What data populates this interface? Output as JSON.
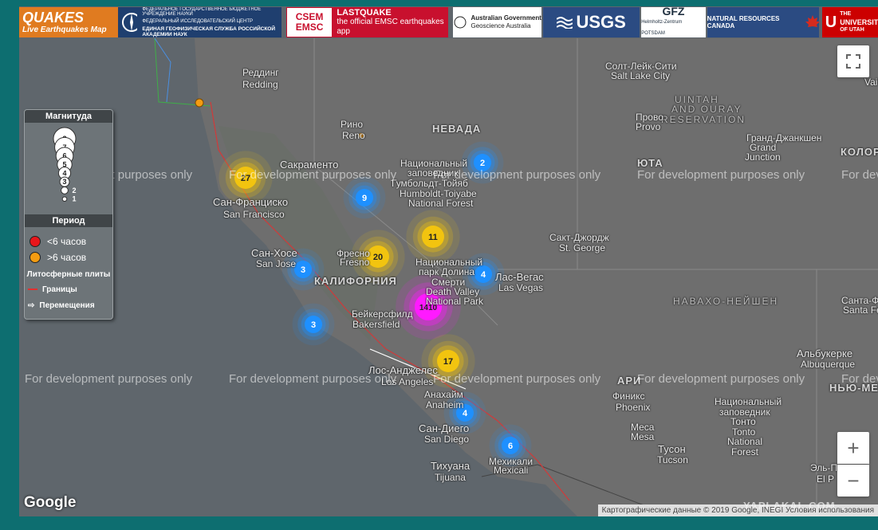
{
  "header": {
    "quakes_title": "QUAKES",
    "quakes_subtitle": "Live Earthquakes Map",
    "ru_line1": "ФЕДЕРАЛЬНОЕ ГОСУДАРСТВЕННОЕ БЮДЖЕТНОЕ УЧРЕЖДЕНИЕ НАУКИ",
    "ru_line2": "ФЕДЕРАЛЬНЫЙ ИССЛЕДОВАТЕЛЬСКИЙ ЦЕНТР",
    "ru_line3": "ЕДИНАЯ ГЕОФИЗИЧЕСКАЯ СЛУЖБА РОССИЙСКОЙ АКАДЕМИИ НАУК",
    "emsc_box1": "CSEM",
    "emsc_box2": "EMSC",
    "emsc_title": "LASTQUAKE",
    "emsc_sub": "the official EMSC earthquakes app",
    "aus_line1": "Australian Government",
    "aus_line2": "Geoscience Australia",
    "usgs": "USGS",
    "gfz": "GFZ",
    "gfz_sub": "Helmholtz-Zentrum POTSDAM",
    "nrc": "NATURAL RESOURCES CANADA",
    "utah_line1": "THE",
    "utah_line2": "UNIVERSITY",
    "utah_line3": "OF UTAH"
  },
  "legend": {
    "magnitude_title": "Магнитуда",
    "magnitude_values": [
      "8",
      "7",
      "6",
      "5",
      "4",
      "3",
      "2",
      "1"
    ],
    "period_title": "Период",
    "period_recent": "<6 часов",
    "period_older": ">6 часов",
    "plates_title": "Литосферные плиты",
    "plates_borders": "Границы",
    "plates_moves": "Перемещения",
    "colors": {
      "recent": "#e8161b",
      "older": "#f39c12",
      "border_line": "#e03030"
    }
  },
  "watermark": "For development purposes only",
  "map_labels": [
    {
      "id": "salt-lake-city-ru",
      "text": "Солт-Лейк-Сити"
    },
    {
      "id": "salt-lake-city",
      "text": "Salt Lake City"
    },
    {
      "id": "uintah-1",
      "text": "UINTAH"
    },
    {
      "id": "uintah-2",
      "text": "AND OURAY"
    },
    {
      "id": "uintah-3",
      "text": "RESERVATION"
    },
    {
      "id": "provo-ru",
      "text": "Прово"
    },
    {
      "id": "provo",
      "text": "Provo"
    },
    {
      "id": "nevada",
      "text": "НЕВАДА"
    },
    {
      "id": "utah",
      "text": "ЮТА"
    },
    {
      "id": "reno-ru",
      "text": "Рино"
    },
    {
      "id": "reno",
      "text": "Reno"
    },
    {
      "id": "redding-ru",
      "text": "Реддинг"
    },
    {
      "id": "redding",
      "text": "Redding"
    },
    {
      "id": "sacramento-ru",
      "text": "Сакраменто"
    },
    {
      "id": "sf-ru",
      "text": "Сан-Франциско"
    },
    {
      "id": "sf",
      "text": "San Francisco"
    },
    {
      "id": "humboldt-1",
      "text": "Национальный"
    },
    {
      "id": "humboldt-2",
      "text": "заповедник"
    },
    {
      "id": "humboldt-3",
      "text": "Гумбольдт-Тойяб"
    },
    {
      "id": "humboldt-4",
      "text": "Humboldt-Toiyabe"
    },
    {
      "id": "humboldt-5",
      "text": "National Forest"
    },
    {
      "id": "grand-junction-ru",
      "text": "Гранд-Джанкшен"
    },
    {
      "id": "grand-junction-1",
      "text": "Grand"
    },
    {
      "id": "grand-junction-2",
      "text": "Junction"
    },
    {
      "id": "st-george-ru",
      "text": "Сакт-Джордж"
    },
    {
      "id": "st-george",
      "text": "St. George"
    },
    {
      "id": "san-jose-ru",
      "text": "Сан-Хосе"
    },
    {
      "id": "san-jose",
      "text": "San Jose"
    },
    {
      "id": "fresno-ru",
      "text": "Фресно"
    },
    {
      "id": "fresno",
      "text": "Fresno"
    },
    {
      "id": "california",
      "text": "КАЛИФОРНИЯ"
    },
    {
      "id": "death-valley-1",
      "text": "Национальный"
    },
    {
      "id": "death-valley-2",
      "text": "парк Долина"
    },
    {
      "id": "death-valley-3",
      "text": "Смерти"
    },
    {
      "id": "death-valley-4",
      "text": "Death Valley"
    },
    {
      "id": "death-valley-5",
      "text": "National Park"
    },
    {
      "id": "las-vegas-ru",
      "text": "Лас-Вегас"
    },
    {
      "id": "las-vegas",
      "text": "Las Vegas"
    },
    {
      "id": "navajo",
      "text": "НАВАХО-НЕЙШЕН"
    },
    {
      "id": "bakersfield-ru",
      "text": "Бейкерсфилд"
    },
    {
      "id": "bakersfield",
      "text": "Bakersfield"
    },
    {
      "id": "los-angeles-ru",
      "text": "Лос-Анджелес"
    },
    {
      "id": "los-angeles",
      "text": "Los Angeles"
    },
    {
      "id": "anaheim-ru",
      "text": "Анахайм"
    },
    {
      "id": "anaheim",
      "text": "Anaheim"
    },
    {
      "id": "arizona",
      "text": "АРИ"
    },
    {
      "id": "phoenix-ru",
      "text": "Финикс"
    },
    {
      "id": "phoenix",
      "text": "Phoenix"
    },
    {
      "id": "tonto-1",
      "text": "Национальный"
    },
    {
      "id": "tonto-2",
      "text": "заповедник"
    },
    {
      "id": "tonto-3",
      "text": "Тонто"
    },
    {
      "id": "tonto-4",
      "text": "Tonto"
    },
    {
      "id": "tonto-5",
      "text": "National"
    },
    {
      "id": "tonto-6",
      "text": "Forest"
    },
    {
      "id": "mesa-ru",
      "text": "Меса"
    },
    {
      "id": "mesa",
      "text": "Mesa"
    },
    {
      "id": "san-diego-ru",
      "text": "Сан-Диего"
    },
    {
      "id": "san-diego",
      "text": "San Diego"
    },
    {
      "id": "mexicali-ru",
      "text": "Мехикали"
    },
    {
      "id": "mexicali",
      "text": "Mexicali"
    },
    {
      "id": "tijuana-ru",
      "text": "Тихуана"
    },
    {
      "id": "tijuana",
      "text": "Tijuana"
    },
    {
      "id": "tucson-ru",
      "text": "Тусон"
    },
    {
      "id": "tucson",
      "text": "Tucson"
    },
    {
      "id": "albuquerque-ru",
      "text": "Альбукерке"
    },
    {
      "id": "albuquerque",
      "text": "Albuquerque"
    },
    {
      "id": "santa-fe-ru",
      "text": "Санта-Ф"
    },
    {
      "id": "santa-fe",
      "text": "Santa Fe"
    },
    {
      "id": "new-mexico",
      "text": "НЬЮ-МЕКСИ"
    },
    {
      "id": "el-paso-ru",
      "text": "Эль-П"
    },
    {
      "id": "el-paso",
      "text": "El P"
    },
    {
      "id": "colorado",
      "text": "КОЛОРА"
    },
    {
      "id": "vail",
      "text": "Vail"
    }
  ],
  "clusters": [
    {
      "id": "cluster-27",
      "count": "27",
      "color": "#f2c40f"
    },
    {
      "id": "cluster-2",
      "count": "2",
      "color": "#1e90ff"
    },
    {
      "id": "cluster-9",
      "count": "9",
      "color": "#1e90ff"
    },
    {
      "id": "cluster-11",
      "count": "11",
      "color": "#f2c40f"
    },
    {
      "id": "cluster-20",
      "count": "20",
      "color": "#f2c40f"
    },
    {
      "id": "cluster-3a",
      "count": "3",
      "color": "#1e90ff"
    },
    {
      "id": "cluster-4a",
      "count": "4",
      "color": "#1e90ff"
    },
    {
      "id": "cluster-1410",
      "count": "1410",
      "color": "#ff1aff"
    },
    {
      "id": "cluster-3b",
      "count": "3",
      "color": "#1e90ff"
    },
    {
      "id": "cluster-17",
      "count": "17",
      "color": "#f2c40f"
    },
    {
      "id": "cluster-4b",
      "count": "4",
      "color": "#1e90ff"
    },
    {
      "id": "cluster-6",
      "count": "6",
      "color": "#1e90ff"
    }
  ],
  "controls": {
    "zoom_in": "+",
    "zoom_out": "−",
    "attribution": "Картографические данные © 2019 Google, INEGI   Условия использования",
    "google": "Google",
    "site_watermark": "YAPLAKAL.COM"
  }
}
